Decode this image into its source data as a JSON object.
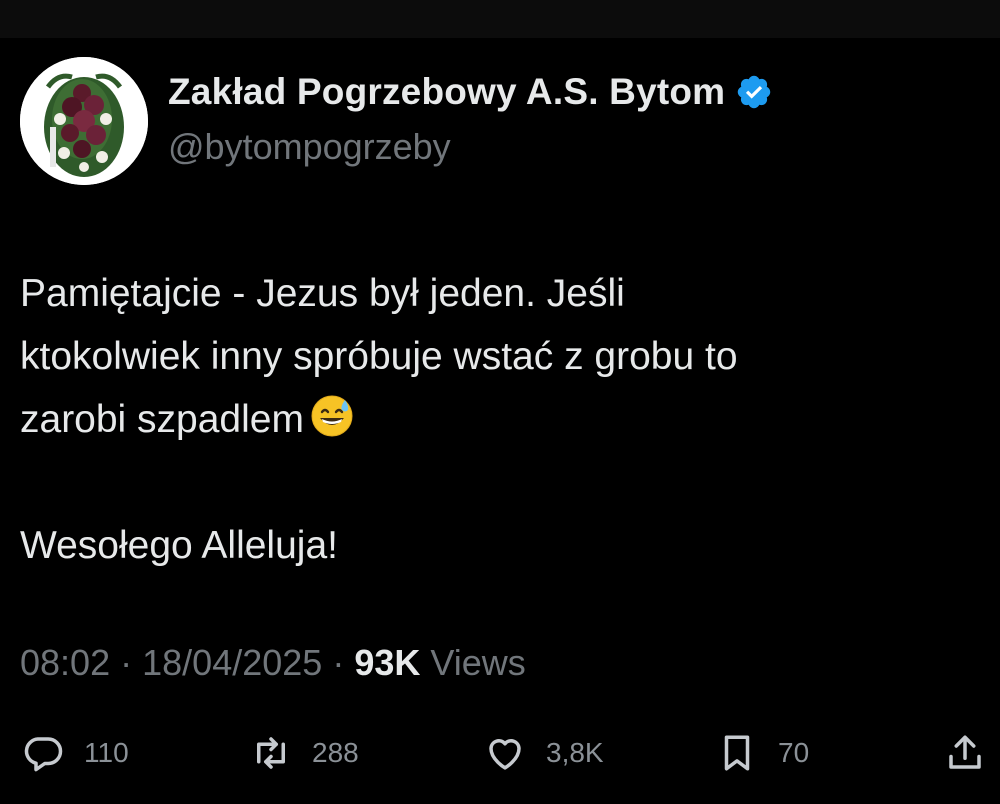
{
  "author": {
    "display_name": "Zakład Pogrzebowy A.S. Bytom",
    "handle": "@bytompogrzeby",
    "verified": true,
    "avatar": "funeral-wreath-image"
  },
  "tweet": {
    "lines": [
      "Pamiętajcie - Jezus był jeden. Jeśli",
      "ktokolwiek inny spróbuje wstać z grobu to",
      "zarobi szpadlem"
    ],
    "emoji": "grinning-face-with-sweat",
    "closing": "Wesołego Alleluja!"
  },
  "meta": {
    "time": "08:02",
    "date": "18/04/2025",
    "views_count": "93K",
    "views_label": "Views",
    "separator": "·"
  },
  "actions": {
    "replies": "110",
    "reposts": "288",
    "likes": "3,8K",
    "bookmarks": "70"
  },
  "colors": {
    "background": "#000000",
    "text": "#e7e9ea",
    "muted": "#71767b",
    "verified": "#1d9bf0"
  }
}
